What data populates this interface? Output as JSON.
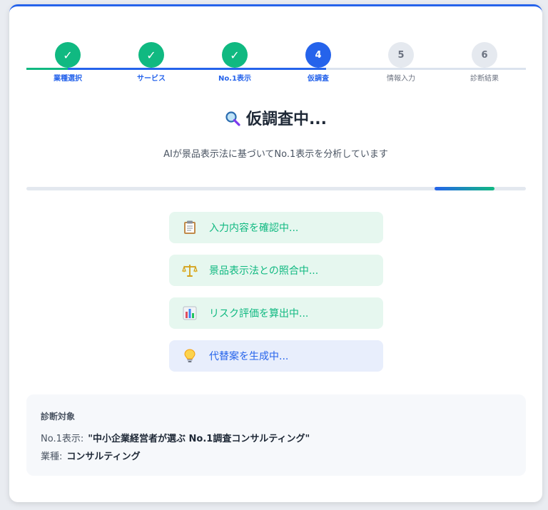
{
  "stepper": {
    "steps": [
      {
        "label": "業種選択",
        "state": "done",
        "mark": "✓"
      },
      {
        "label": "サービス",
        "state": "done",
        "mark": "✓"
      },
      {
        "label": "No.1表示",
        "state": "done",
        "mark": "✓"
      },
      {
        "label": "仮調査",
        "state": "active",
        "mark": "4"
      },
      {
        "label": "情報入力",
        "state": "pending",
        "mark": "5"
      },
      {
        "label": "診断結果",
        "state": "pending",
        "mark": "6"
      }
    ]
  },
  "main": {
    "title": "仮調査中...",
    "title_icon": "magnifier-icon",
    "subtitle": "AIが景品表示法に基づいてNo.1表示を分析しています"
  },
  "progress": {
    "value": 0.12
  },
  "tasks": [
    {
      "label": "入力内容を確認中...",
      "icon": "clipboard-icon",
      "state": "done"
    },
    {
      "label": "景品表示法との照合中...",
      "icon": "scales-icon",
      "state": "done"
    },
    {
      "label": "リスク評価を算出中...",
      "icon": "bar-chart-icon",
      "state": "done"
    },
    {
      "label": "代替案を生成中...",
      "icon": "lightbulb-icon",
      "state": "active"
    }
  ],
  "target": {
    "heading": "診断対象",
    "no1_label": "No.1表示:",
    "no1_value": "\"中小企業経営者が選ぶ No.1調査コンサルティング\"",
    "industry_label": "業種:",
    "industry_value": "コンサルティング"
  },
  "colors": {
    "primary": "#2563eb",
    "success": "#10b981",
    "pending": "#e5e9ef"
  }
}
